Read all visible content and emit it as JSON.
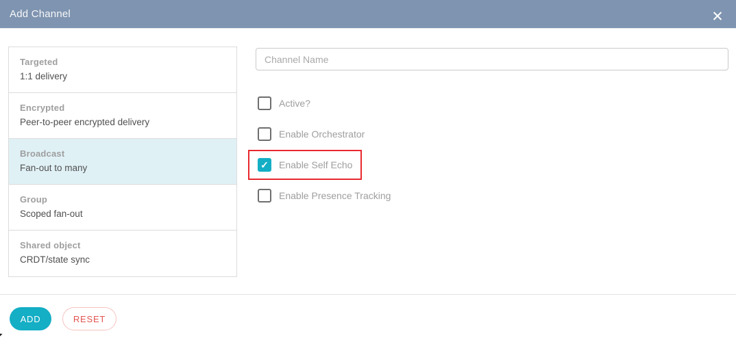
{
  "colors": {
    "header_bg": "#7e94b0",
    "accent_teal": "#14aec5",
    "selected_item_bg": "#e0f1f6",
    "highlight_red": "#e8282d",
    "reset_border": "#f6c3c0",
    "reset_text": "#e25350"
  },
  "header": {
    "title": "Add Channel",
    "close_glyph": "✕"
  },
  "channel_types": [
    {
      "title": "Targeted",
      "subtitle": "1:1 delivery",
      "selected": false
    },
    {
      "title": "Encrypted",
      "subtitle": "Peer-to-peer encrypted delivery",
      "selected": false
    },
    {
      "title": "Broadcast",
      "subtitle": "Fan-out to many",
      "selected": true
    },
    {
      "title": "Group",
      "subtitle": "Scoped fan-out",
      "selected": false
    },
    {
      "title": "Shared object",
      "subtitle": "CRDT/state sync",
      "selected": false
    }
  ],
  "form": {
    "channel_name": {
      "value": "",
      "placeholder": "Channel Name"
    },
    "checkboxes": [
      {
        "label": "Active?",
        "checked": false,
        "highlighted": false
      },
      {
        "label": "Enable Orchestrator",
        "checked": false,
        "highlighted": false
      },
      {
        "label": "Enable Self Echo",
        "checked": true,
        "highlighted": true
      },
      {
        "label": "Enable Presence Tracking",
        "checked": false,
        "highlighted": false
      }
    ],
    "check_glyph": "✓"
  },
  "actions": {
    "add_label": "ADD",
    "reset_label": "RESET"
  }
}
